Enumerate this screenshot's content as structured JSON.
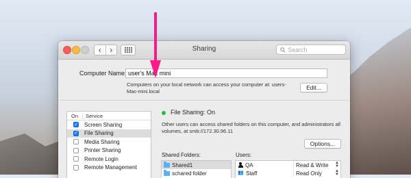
{
  "window": {
    "title": "Sharing",
    "search_placeholder": "Search",
    "nav_back": "‹",
    "nav_forward": "›"
  },
  "computer_name": {
    "label": "Computer Name:",
    "value": "user's Mac mini",
    "info": "Computers on your local network can access your computer at: users-Mac-mini.local",
    "edit_button": "Edit..."
  },
  "services": {
    "header_on": "On",
    "header_service": "Service",
    "items": [
      {
        "label": "Screen Sharing",
        "checked": true
      },
      {
        "label": "File Sharing",
        "checked": true,
        "selected": true
      },
      {
        "label": "Media Sharing",
        "checked": false
      },
      {
        "label": "Printer Sharing",
        "checked": false
      },
      {
        "label": "Remote Login",
        "checked": false
      },
      {
        "label": "Remote Management",
        "checked": false
      }
    ]
  },
  "file_sharing": {
    "status": "File Sharing: On",
    "status_color": "#2bbd3f",
    "description": "Other users can access shared folders on this computer, and administrators all volumes, at smb://172.30.96.11",
    "options_button": "Options...",
    "shared_folders_label": "Shared Folders:",
    "users_label": "Users:",
    "folders": [
      "Shared1",
      "schared folder"
    ],
    "users": [
      {
        "name": "QA",
        "icon": "person-icon",
        "permission": "Read & Write"
      },
      {
        "name": "Staff",
        "icon": "group-icon",
        "permission": "Read Only"
      }
    ]
  },
  "annotation": {
    "arrow_color": "#ff1a8c"
  }
}
